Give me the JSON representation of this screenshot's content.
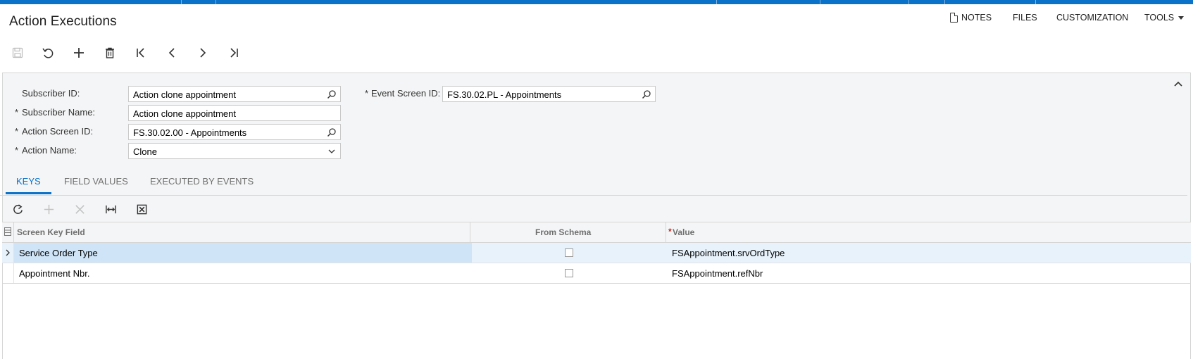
{
  "page": {
    "title": "Action Executions"
  },
  "top_links": {
    "notes": "NOTES",
    "files": "FILES",
    "customization": "CUSTOMIZATION",
    "tools": "TOOLS"
  },
  "toolbar": {
    "icons": [
      "save-icon",
      "undo-icon",
      "add-icon",
      "delete-icon",
      "first-icon",
      "previous-icon",
      "next-icon",
      "last-icon"
    ]
  },
  "form": {
    "subscriber_id_label": "Subscriber ID:",
    "subscriber_id_value": "Action clone appointment",
    "subscriber_name_label": "Subscriber Name:",
    "subscriber_name_value": "Action clone appointment",
    "action_screen_id_label": "Action Screen ID:",
    "action_screen_id_value": "FS.30.02.00 - Appointments",
    "action_name_label": "Action Name:",
    "action_name_value": "Clone",
    "event_screen_id_label": "Event Screen ID:",
    "event_screen_id_value": "FS.30.02.PL - Appointments",
    "required_marker": "*"
  },
  "tabs": [
    {
      "label": "KEYS",
      "active": true
    },
    {
      "label": "FIELD VALUES",
      "active": false
    },
    {
      "label": "EXECUTED BY EVENTS",
      "active": false
    }
  ],
  "grid": {
    "columns": {
      "screen_key_field": "Screen Key Field",
      "from_schema": "From Schema",
      "value": "Value"
    },
    "rows": [
      {
        "screen_key_field": "Service Order Type",
        "from_schema": false,
        "value": "FSAppointment.srvOrdType"
      },
      {
        "screen_key_field": "Appointment Nbr.",
        "from_schema": false,
        "value": "FSAppointment.refNbr"
      }
    ]
  },
  "colors": {
    "accent": "#0a72c9",
    "required": "#c4261d"
  }
}
